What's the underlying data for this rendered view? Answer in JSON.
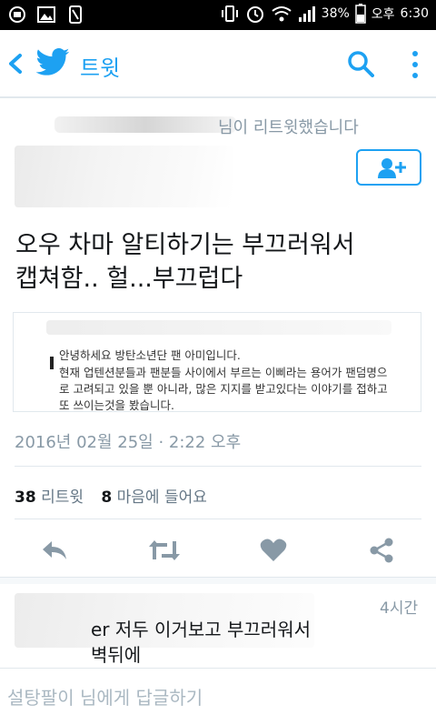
{
  "status_bar": {
    "battery": "38%",
    "ampm": "오후",
    "time": "6:30"
  },
  "app_bar": {
    "title": "트윗"
  },
  "tweet": {
    "retweet_context": "님이 리트윗했습니다",
    "text_line1": "오우 차마 알티하기는 부끄러워서",
    "text_line2": "캡쳐함.. 헐...부끄럽다",
    "embedded": {
      "line1": "안녕하세요 방탄소년단 팬 아미입니다.",
      "line2": "현재 업텐션분들과 팬분들 사이에서 부르는 이삐라는 용어가 팬덤명으",
      "line3": "로 고려되고 있을 뿐 아니라, 많은 지지를 받고있다는 이야기를 접하고",
      "line4": "또 쓰이는것을 봤습니다."
    },
    "timestamp": "2016년 02월 25일 · 2:22 오후",
    "retweets_count": "38",
    "retweets_label": "리트윗",
    "likes_count": "8",
    "likes_label": "마음에 들어요"
  },
  "reply": {
    "time": "4시간",
    "partial_lead": "er",
    "text": "저두 이거보고 부끄러워서",
    "text2": "벽뒤에"
  },
  "composer": {
    "placeholder": "설탕팔이 님에게 답글하기"
  },
  "colors": {
    "accent": "#1da1f2",
    "muted": "#8899a6",
    "icon_gray": "#8899a6"
  }
}
